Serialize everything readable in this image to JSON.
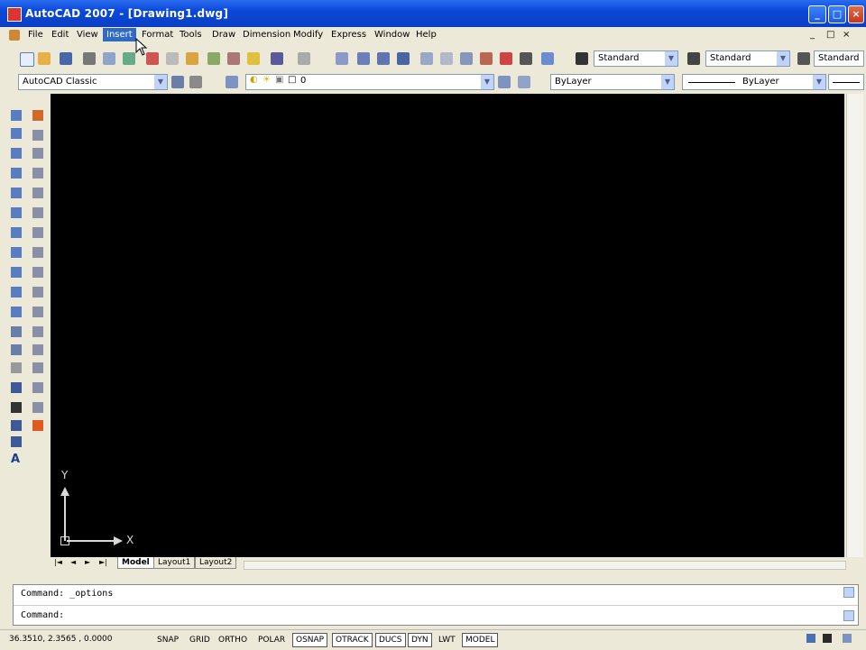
{
  "window": {
    "title": "AutoCAD 2007 - [Drawing1.dwg]",
    "min": "_",
    "max": "□",
    "close": "×"
  },
  "menu": {
    "items": [
      "File",
      "Edit",
      "View",
      "Insert",
      "Format",
      "Tools",
      "Draw",
      "Dimension",
      "Modify",
      "Express",
      "Window",
      "Help"
    ],
    "active": "Insert",
    "mdi": [
      "_",
      "□",
      "×"
    ]
  },
  "toolbar1": {
    "text_style": "Standard",
    "dim_style": "Standard",
    "table_style": "Standard"
  },
  "toolbar2": {
    "workspace": "AutoCAD Classic",
    "layer": "0",
    "color": "ByLayer",
    "linetype": "ByLayer"
  },
  "ucs": {
    "y": "Y",
    "x": "X"
  },
  "layout_tabs": {
    "nav": [
      "|◄",
      "◄",
      "►",
      "►|"
    ],
    "tabs": [
      "Model",
      "Layout1",
      "Layout2"
    ],
    "active": "Model"
  },
  "command": {
    "history": "Command:  _options",
    "prompt": "Command:"
  },
  "status": {
    "coords": "36.3510, 2.3565 , 0.0000",
    "buttons": [
      {
        "label": "SNAP",
        "on": false
      },
      {
        "label": "GRID",
        "on": false
      },
      {
        "label": "ORTHO",
        "on": false
      },
      {
        "label": "POLAR",
        "on": false
      },
      {
        "label": "OSNAP",
        "on": true
      },
      {
        "label": "OTRACK",
        "on": true
      },
      {
        "label": "DUCS",
        "on": true
      },
      {
        "label": "DYN",
        "on": true
      },
      {
        "label": "LWT",
        "on": false
      },
      {
        "label": "MODEL",
        "on": true
      }
    ]
  },
  "colors": {
    "canvas": "#000000",
    "titlebar": "#0a48d8",
    "chrome": "#ece9d8",
    "menu_highlight": "#316ac5"
  }
}
